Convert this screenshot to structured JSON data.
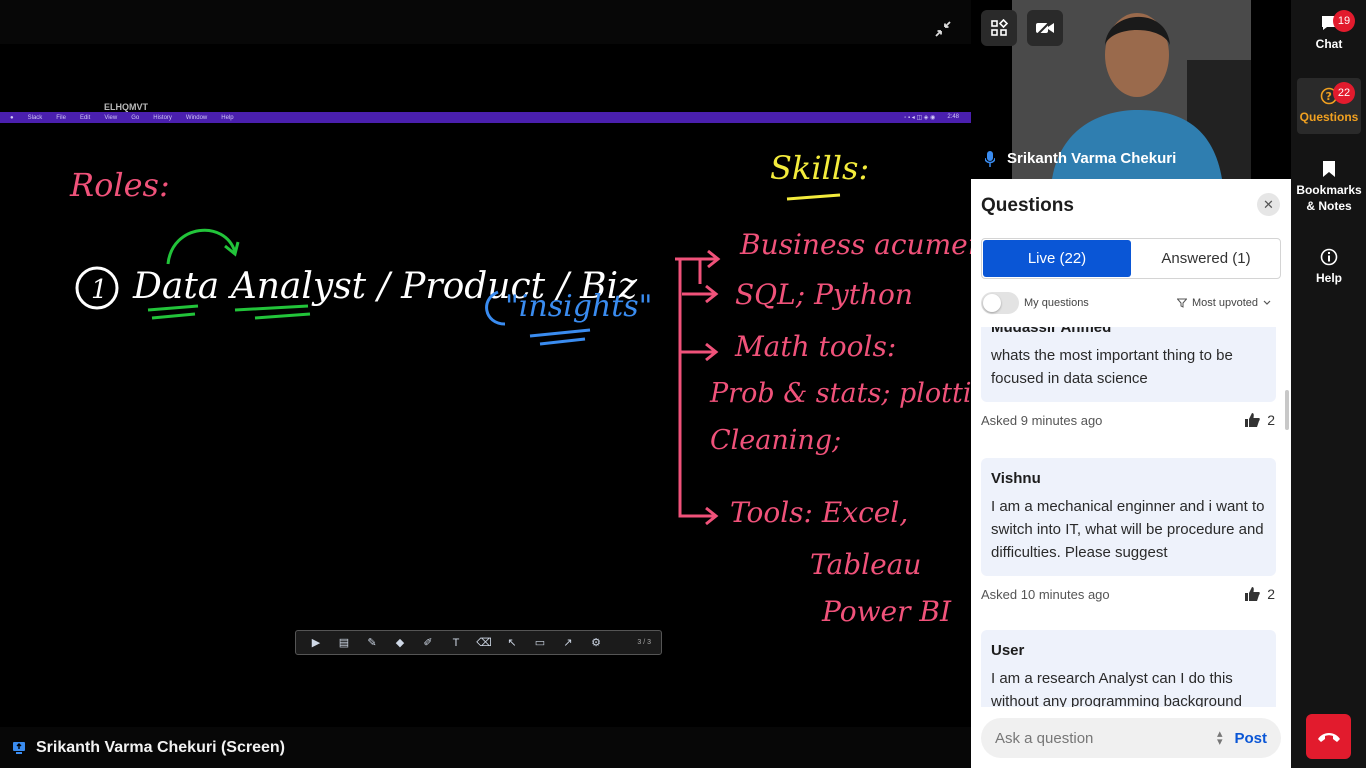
{
  "presentation": {
    "mac_window_title": "ELHQMVT",
    "mac_menu": [
      "Slack",
      "File",
      "Edit",
      "View",
      "Go",
      "History",
      "Window",
      "Help"
    ],
    "mac_clock": "2:48",
    "whiteboard": {
      "roles_heading": "Roles:",
      "role_line": "① Data Analyst / Product / Biz",
      "insights": "\"insights\"",
      "skills_heading": "Skills:",
      "skills": [
        "Business acumen",
        "SQL; Python",
        "Math tools:",
        "Prob & stats; plotting;",
        "Cleaning;",
        "Tools: Excel,",
        "Tableau",
        "Power BI"
      ]
    },
    "toolbar_pager": "3 / 3",
    "screen_share_name": "Srikanth Varma Chekuri (Screen)"
  },
  "video": {
    "presenter_name": "Srikanth Varma Chekuri"
  },
  "questions_panel": {
    "title": "Questions",
    "tabs": [
      {
        "label": "Live (22)",
        "active": true
      },
      {
        "label": "Answered (1)",
        "active": false
      }
    ],
    "my_questions_label": "My questions",
    "sort_label": "Most upvoted",
    "questions": [
      {
        "author": "Mudassir Ahmed",
        "text": "whats the most important thing to be focused in data science",
        "asked": "Asked 9 minutes ago",
        "votes": "2"
      },
      {
        "author": "Vishnu",
        "text": "I am a mechanical enginner and i want to switch into IT, what will be procedure and difficulties. Please suggest",
        "asked": "Asked 10 minutes ago",
        "votes": "2"
      },
      {
        "author": "User",
        "text": "I am a research Analyst can I do this without any programming background",
        "asked": "",
        "votes": ""
      }
    ],
    "ask_placeholder": "Ask a question",
    "post_label": "Post"
  },
  "rail": {
    "chat_label": "Chat",
    "chat_badge": "19",
    "questions_label": "Questions",
    "questions_badge": "22",
    "bookmarks_label": "Bookmarks & Notes",
    "help_label": "Help"
  },
  "colors": {
    "accent_blue": "#0a56d6",
    "badge_red": "#e21b2d",
    "active_rail": "#f0a020",
    "ink_pink": "#f0527a",
    "ink_white": "#ffffff",
    "ink_yellow": "#f4ec3c",
    "ink_green": "#22c43a",
    "ink_blue": "#3a8cf0"
  }
}
